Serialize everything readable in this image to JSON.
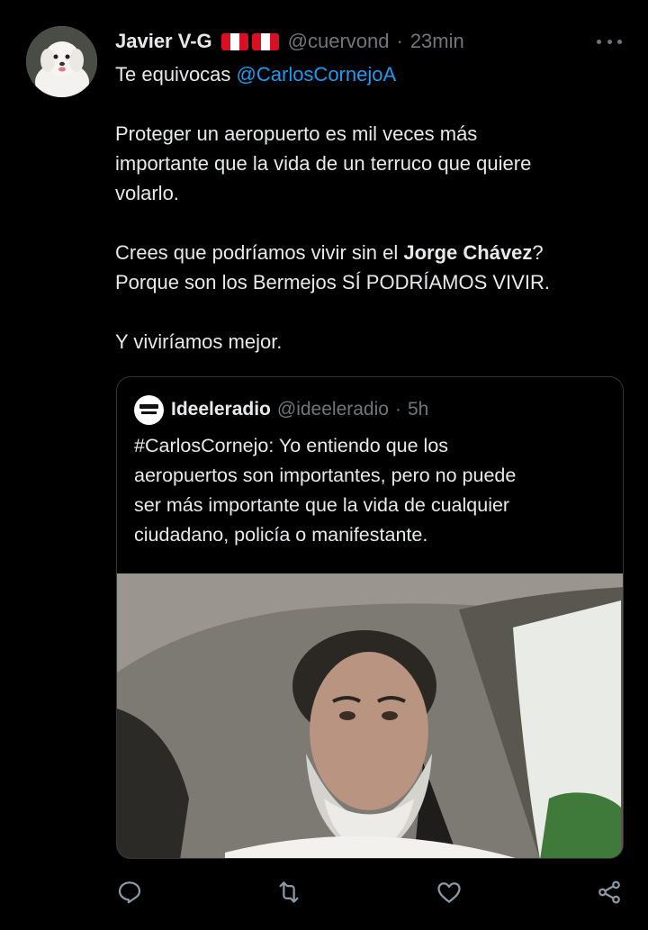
{
  "tweet": {
    "author_name": "Javier V-G",
    "handle": "@cuervond",
    "separator": "·",
    "time": "23min",
    "lines": {
      "l1_prefix": "Te equivocas ",
      "l1_mention": "@CarlosCornejoA",
      "l2": "Proteger un aeropuerto es mil veces más",
      "l3": "importante que la vida de un terruco que quiere",
      "l4": "volarlo.",
      "l5_prefix": "Crees que podríamos vivir sin el ",
      "l5_bold": "Jorge Chávez",
      "l5_suffix": "?",
      "l6": "Porque son los Bermejos SÍ PODRÍAMOS VIVIR.",
      "l7": "Y viviríamos mejor."
    }
  },
  "quote": {
    "author_name": "Ideeleradio",
    "handle": "@ideeleradio",
    "separator": "·",
    "time": "5h",
    "lines": {
      "l1": "#CarlosCornejo:  Yo entiendo que los",
      "l2": "aeropuertos son importantes, pero no puede",
      "l3": "ser más importante que la vida de cualquier",
      "l4": "ciudadano, policía o manifestante."
    }
  },
  "icons": {
    "more": "more-horizontal-icon",
    "reply": "reply-icon",
    "retweet": "retweet-icon",
    "like": "like-icon",
    "share": "share-icon"
  },
  "colors": {
    "background": "#000000",
    "text": "#e7e9ea",
    "muted": "#71767b",
    "link": "#1d9bf0",
    "border": "#333639",
    "flag_red": "#d91023"
  }
}
